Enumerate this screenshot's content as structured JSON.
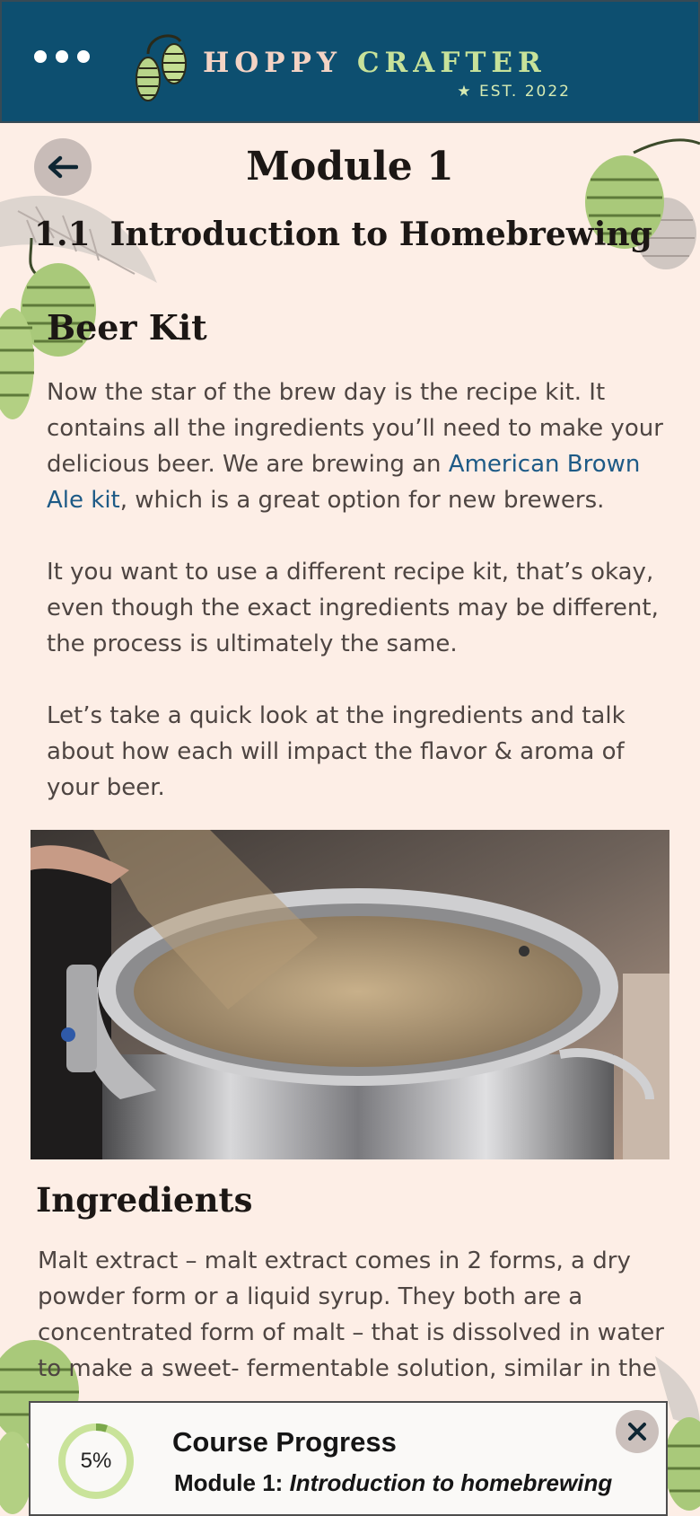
{
  "header": {
    "menu_icon": "more-dots-icon",
    "brand_word1": "HOPPY",
    "brand_word2": "CRAFTER",
    "established": "★ EST. 2022",
    "brand_colors": {
      "background": "#0d4f70",
      "hoppy": "#f4d3c4",
      "crafter": "#c7e29a"
    }
  },
  "page": {
    "back_icon": "arrow-left-icon",
    "module_title": "Module 1",
    "section_number": "1.1",
    "section_title": "Introduction to Homebrewing"
  },
  "beer_kit": {
    "heading": "Beer Kit",
    "p1_before": "Now the star of the brew day is the recipe kit. It contains all the ingredients you’ll need to make your delicious beer. We are brewing an ",
    "p1_link": "American Brown Ale kit",
    "p1_after": ", which is a great option for new brewers.",
    "p2": "It you want to use a different recipe kit, that’s okay, even though the exact ingredients may be different, the process is ultimately the same.",
    "p3": "Let’s take a quick look at the ingredients and talk about how each will impact the flavor & aroma of your beer."
  },
  "ingredients": {
    "heading": "Ingredients",
    "p1": "Malt extract – malt extract comes in 2 forms, a dry powder form or a liquid syrup. They both are a concentrated form of malt – that is dissolved in water to make a sweet- fermentable solution, similar in the"
  },
  "course_progress": {
    "percent_label": "5%",
    "percent_value": 5,
    "title": "Course Progress",
    "module_label": "Module 1:",
    "module_name": "Introduction to homebrewing",
    "close_icon": "close-x-icon",
    "ring_color": "#c9e39a"
  }
}
